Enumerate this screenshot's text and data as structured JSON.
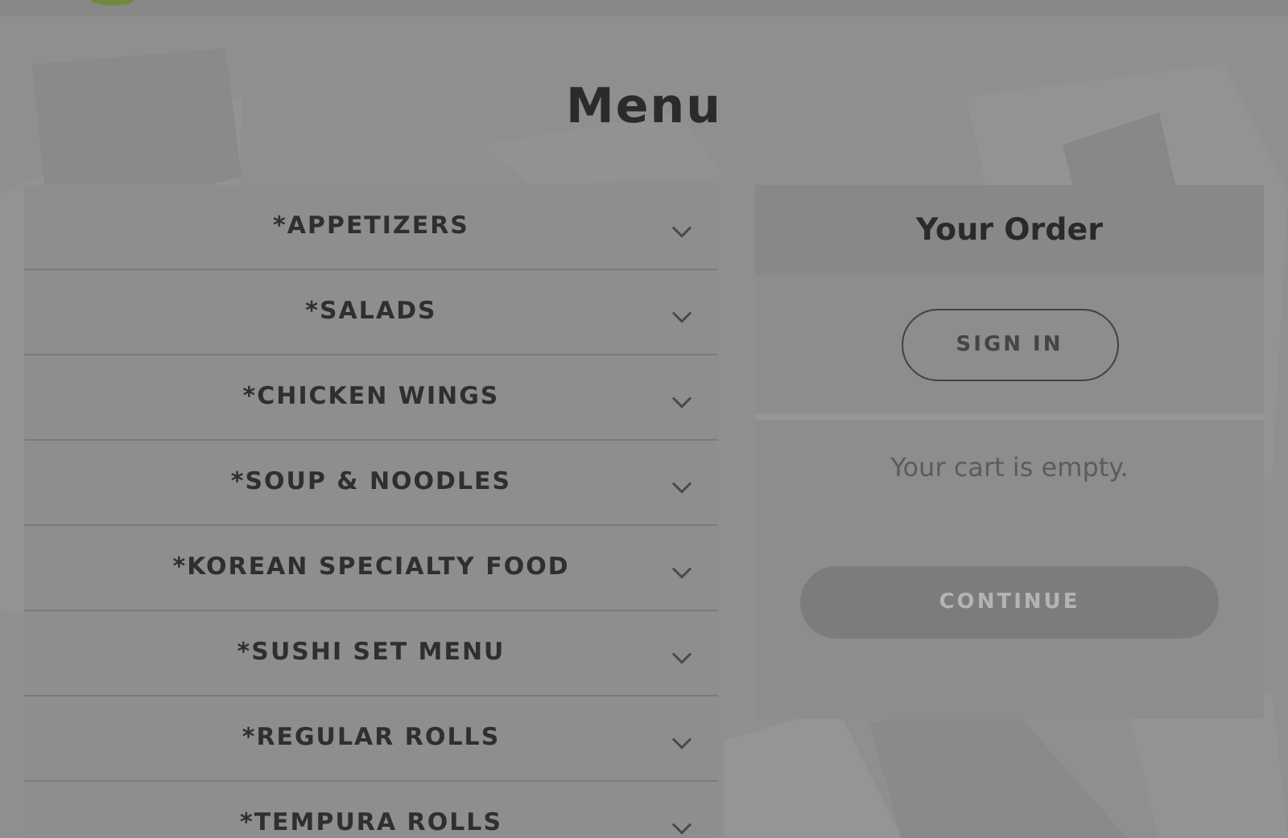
{
  "page": {
    "title": "Menu"
  },
  "categories": [
    {
      "label": "*APPETIZERS",
      "expanded": false
    },
    {
      "label": "*SALADS",
      "expanded": false
    },
    {
      "label": "*CHICKEN WINGS",
      "expanded": false
    },
    {
      "label": "*SOUP & NOODLES",
      "expanded": false
    },
    {
      "label": "*KOREAN SPECIALTY FOOD",
      "expanded": false
    },
    {
      "label": "*SUSHI SET MENU",
      "expanded": false
    },
    {
      "label": "*REGULAR ROLLS",
      "expanded": false
    },
    {
      "label": "*TEMPURA ROLLS",
      "expanded": false
    }
  ],
  "order": {
    "title": "Your Order",
    "sign_in": "SIGN IN",
    "empty_message": "Your cart is empty.",
    "continue": {
      "label": "CONTINUE",
      "disabled": true
    }
  }
}
